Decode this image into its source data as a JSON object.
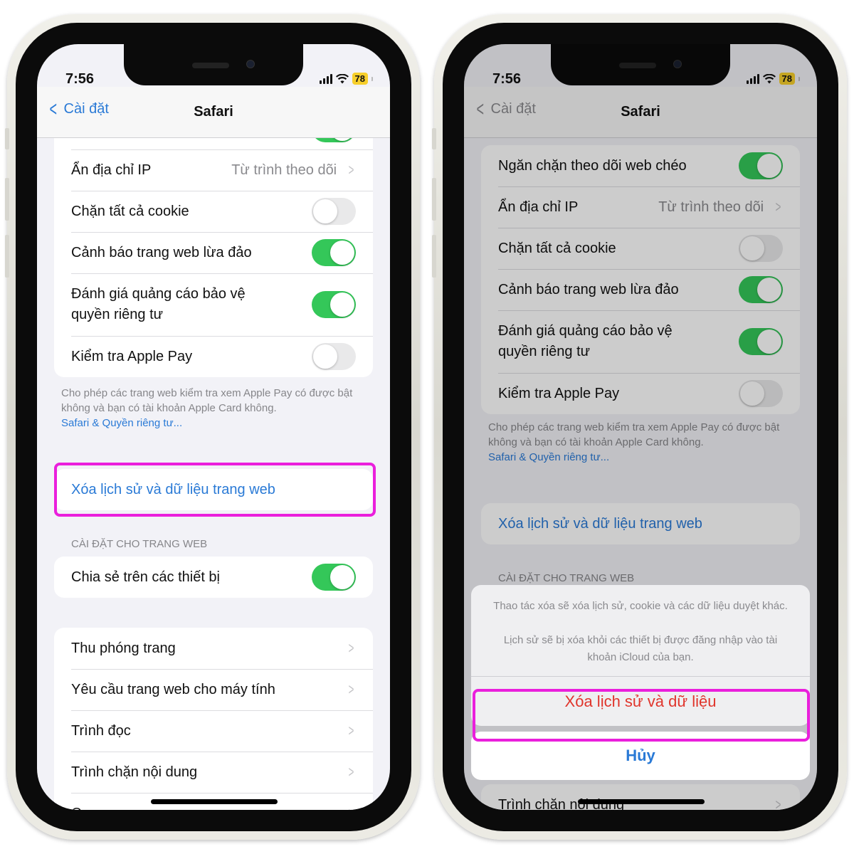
{
  "colors": {
    "accent": "#2a7ad6",
    "toggle_on": "#34c759",
    "destructive": "#e0352c",
    "highlight": "#ea1fdc",
    "battery": "#f7cf2b"
  },
  "status_bar": {
    "time": "7:56",
    "battery": "78",
    "icons": [
      "signal-icon",
      "wifi-icon",
      "battery-icon"
    ]
  },
  "nav": {
    "back_label": "Cài đặt",
    "title": "Safari"
  },
  "left_screen": {
    "privacy_rows": [
      {
        "label": "Ẩn địa chỉ IP",
        "detail": "Từ trình theo dõi",
        "type": "link"
      },
      {
        "label": "Chặn tất cả cookie",
        "type": "toggle",
        "on": false
      },
      {
        "label": "Cảnh báo trang web lừa đảo",
        "type": "toggle",
        "on": true
      },
      {
        "label": "Đánh giá quảng cáo bảo vệ quyền riêng tư",
        "type": "toggle",
        "on": true
      },
      {
        "label": "Kiểm tra Apple Pay",
        "type": "toggle",
        "on": false
      }
    ],
    "footnote": "Cho phép các trang web kiểm tra xem Apple Pay có được bật không và bạn có tài khoản Apple Card không.",
    "footnote_link": "Safari & Quyền riêng tư...",
    "clear_history": "Xóa lịch sử và dữ liệu trang web",
    "section_header": "CÀI ĐẶT CHO TRANG WEB",
    "share_row": {
      "label": "Chia sẻ trên các thiết bị",
      "on": true
    },
    "web_rows": [
      "Thu phóng trang",
      "Yêu cầu trang web cho máy tính",
      "Trình đọc",
      "Trình chặn nội dung",
      "Camera"
    ]
  },
  "right_screen": {
    "privacy_rows": [
      {
        "label": "Ngăn chặn theo dõi web chéo",
        "type": "toggle",
        "on": true
      },
      {
        "label": "Ẩn địa chỉ IP",
        "detail": "Từ trình theo dõi",
        "type": "link"
      },
      {
        "label": "Chặn tất cả cookie",
        "type": "toggle",
        "on": false
      },
      {
        "label": "Cảnh báo trang web lừa đảo",
        "type": "toggle",
        "on": true
      },
      {
        "label": "Đánh giá quảng cáo bảo vệ quyền riêng tư",
        "type": "toggle",
        "on": true
      },
      {
        "label": "Kiểm tra Apple Pay",
        "type": "toggle",
        "on": false
      }
    ],
    "footnote": "Cho phép các trang web kiểm tra xem Apple Pay có được bật không và bạn có tài khoản Apple Card không.",
    "footnote_link": "Safari & Quyền riêng tư...",
    "clear_history": "Xóa lịch sử và dữ liệu trang web",
    "section_header": "CÀI ĐẶT CHO TRANG WEB",
    "behind_row": "Trình chặn nội dung",
    "action_sheet": {
      "message_1": "Thao tác xóa sẽ xóa lịch sử, cookie và các dữ liệu duyệt khác.",
      "message_2": "Lịch sử sẽ bị xóa khỏi các thiết bị được đăng nhập vào tài khoản iCloud của bạn.",
      "destructive_label": "Xóa lịch sử và dữ liệu",
      "cancel_label": "Hủy"
    }
  }
}
